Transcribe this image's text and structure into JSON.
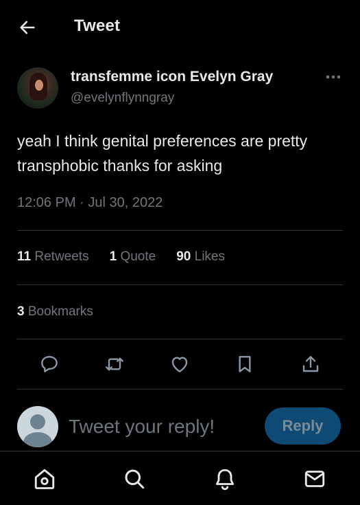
{
  "header": {
    "title": "Tweet",
    "back_icon": "arrow-left-icon"
  },
  "tweet": {
    "author": {
      "display_name": "transfemme icon Evelyn Gray",
      "handle": "@evelynflynngray"
    },
    "text": "yeah I think genital preferences are pretty transphobic thanks for asking",
    "timestamp": "12:06 PM · Jul 30, 2022",
    "stats": {
      "retweets": {
        "count": "11",
        "label": "Retweets"
      },
      "quotes": {
        "count": "1",
        "label": "Quote"
      },
      "likes": {
        "count": "90",
        "label": "Likes"
      },
      "bookmarks": {
        "count": "3",
        "label": "Bookmarks"
      }
    },
    "actions": [
      "reply-icon",
      "retweet-icon",
      "like-icon",
      "bookmark-icon",
      "share-icon"
    ]
  },
  "composer": {
    "placeholder": "Tweet your reply!",
    "button_label": "Reply"
  },
  "bottom_nav": [
    "home-icon",
    "search-icon",
    "notifications-icon",
    "messages-icon"
  ],
  "colors": {
    "background": "#000000",
    "text": "#e7e9ea",
    "secondary_text": "#71767b",
    "divider": "#2f3336",
    "reply_button": "#0e4a74"
  }
}
